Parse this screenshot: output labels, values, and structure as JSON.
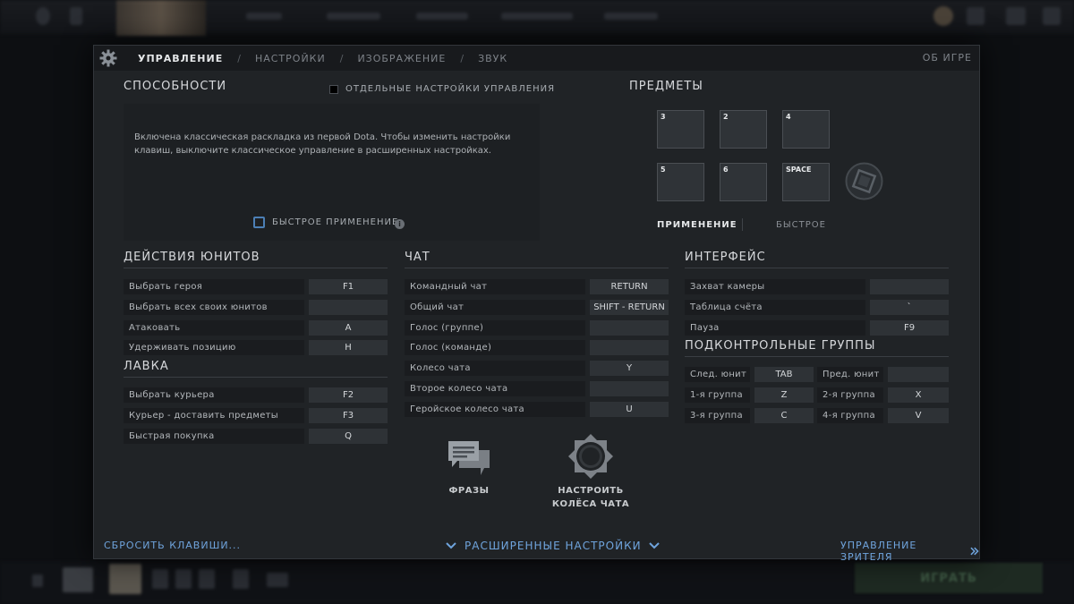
{
  "tabs": [
    {
      "label": "УПРАВЛЕНИЕ"
    },
    {
      "label": "НАСТРОЙКИ"
    },
    {
      "label": "ИЗОБРАЖЕНИЕ"
    },
    {
      "label": "ЗВУК"
    }
  ],
  "tab_about": "ОБ ИГРЕ",
  "abilities": {
    "title": "СПОСОБНОСТИ",
    "separate_settings": "ОТДЕЛЬНЫЕ НАСТРОЙКИ УПРАВЛЕНИЯ",
    "message": "Включена классическая раскладка из первой Dota. Чтобы изменить настройки клавиш, выключите классическое управление в расширенных настройках.",
    "quick_cast": "БЫСТРОЕ ПРИМЕНЕНИЕ"
  },
  "items": {
    "title": "ПРЕДМЕТЫ",
    "slots": [
      "3",
      "2",
      "4",
      "5",
      "6",
      "SPACE"
    ],
    "tab_apply": "ПРИМЕНЕНИЕ",
    "tab_quick": "БЫСТРОЕ"
  },
  "unit_actions": {
    "title": "ДЕЙСТВИЯ ЮНИТОВ",
    "rows": [
      {
        "label": "Выбрать героя",
        "key": "F1"
      },
      {
        "label": "Выбрать всех своих юнитов",
        "key": ""
      },
      {
        "label": "Атаковать",
        "key": "A"
      },
      {
        "label": "Удерживать позицию",
        "key": "H"
      }
    ]
  },
  "shop": {
    "title": "ЛАВКА",
    "rows": [
      {
        "label": "Выбрать курьера",
        "key": "F2"
      },
      {
        "label": "Курьер - доставить предметы",
        "key": "F3"
      },
      {
        "label": "Быстрая покупка",
        "key": "Q"
      }
    ]
  },
  "chat": {
    "title": "ЧАТ",
    "rows": [
      {
        "label": "Командный чат",
        "key": "RETURN"
      },
      {
        "label": "Общий чат",
        "key": "SHIFT - RETURN"
      },
      {
        "label": "Голос (группе)",
        "key": ""
      },
      {
        "label": "Голос (команде)",
        "key": ""
      },
      {
        "label": "Колесо чата",
        "key": "Y"
      },
      {
        "label": "Второе колесо чата",
        "key": ""
      },
      {
        "label": "Геройское колесо чата",
        "key": "U"
      }
    ],
    "phrases_label": "ФРАЗЫ",
    "configure_label_1": "НАСТРОИТЬ",
    "configure_label_2": "КОЛЁСА ЧАТА"
  },
  "interface": {
    "title": "ИНТЕРФЕЙС",
    "rows": [
      {
        "label": "Захват камеры",
        "key": ""
      },
      {
        "label": "Таблица счёта",
        "key": "`"
      },
      {
        "label": "Пауза",
        "key": "F9"
      }
    ]
  },
  "control_groups": {
    "title": "ПОДКОНТРОЛЬНЫЕ ГРУППЫ",
    "rows": [
      {
        "l1": "След. юнит",
        "k1": "TAB",
        "l2": "Пред. юнит",
        "k2": ""
      },
      {
        "l1": "1-я группа",
        "k1": "Z",
        "l2": "2-я группа",
        "k2": "X"
      },
      {
        "l1": "3-я группа",
        "k1": "C",
        "l2": "4-я группа",
        "k2": "V"
      }
    ]
  },
  "footer": {
    "reset": "СБРОСИТЬ КЛАВИШИ...",
    "advanced": "РАСШИРЕННЫЕ НАСТРОЙКИ",
    "spectator": "УПРАВЛЕНИЕ ЗРИТЕЛЯ"
  },
  "colors": {
    "accent_link": "#6fa4dd",
    "panel_bg": "#202326",
    "checkbox_blue": "#4c7fb5"
  }
}
